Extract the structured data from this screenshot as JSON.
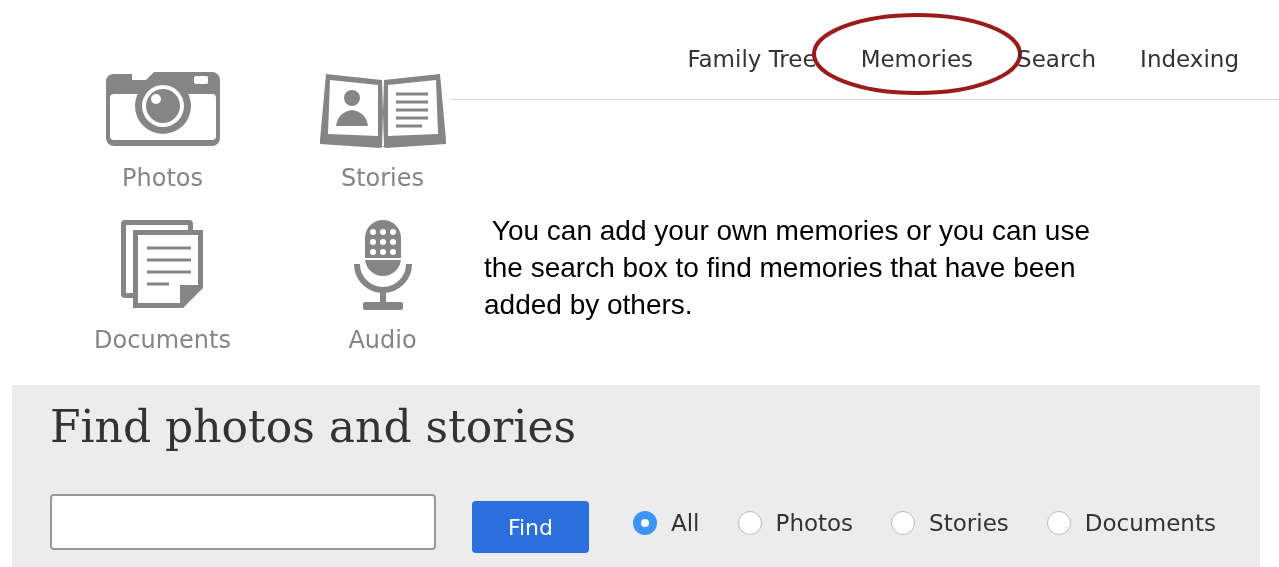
{
  "nav": {
    "items": [
      {
        "label": "Family Tree",
        "selected": false
      },
      {
        "label": "Memories",
        "selected": true
      },
      {
        "label": "Search",
        "selected": false
      },
      {
        "label": "Indexing",
        "selected": false
      }
    ]
  },
  "categories": [
    {
      "kind": "camera",
      "label": "Photos"
    },
    {
      "kind": "book",
      "label": "Stories"
    },
    {
      "kind": "documents",
      "label": "Documents"
    },
    {
      "kind": "microphone",
      "label": "Audio"
    }
  ],
  "note": " You can add your own memories or you can use the search box to find memories that have been added by others.",
  "find_panel": {
    "title": "Find photos and stories",
    "button": "Find",
    "filters": [
      {
        "label": "All",
        "selected": true
      },
      {
        "label": "Photos",
        "selected": false
      },
      {
        "label": "Stories",
        "selected": false
      },
      {
        "label": "Documents",
        "selected": false
      }
    ]
  }
}
